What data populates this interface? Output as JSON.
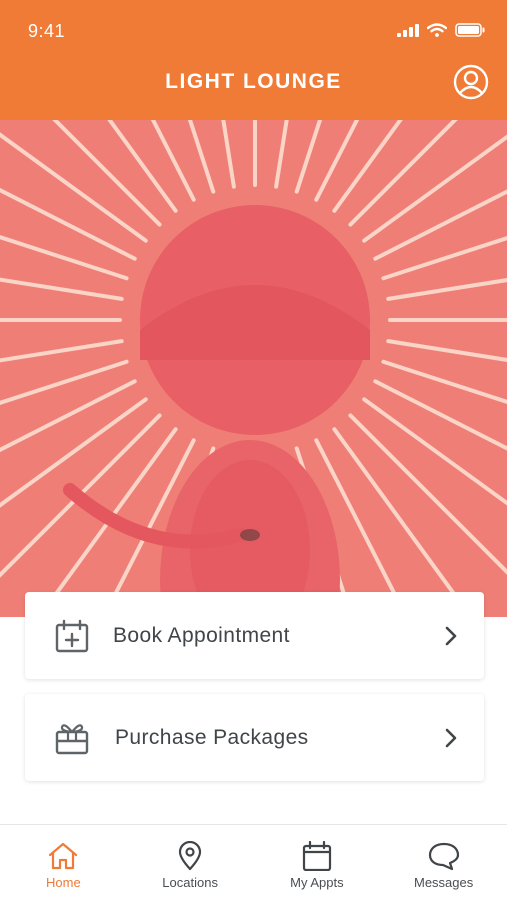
{
  "status_bar": {
    "time": "9:41"
  },
  "header": {
    "title": "LIGHT LOUNGE"
  },
  "carousel": {
    "slide_count": 4,
    "active_index": 0
  },
  "cards": [
    {
      "label": "Book Appointment",
      "icon": "calendar-plus-icon"
    },
    {
      "label": "Purchase Packages",
      "icon": "gift-box-icon"
    }
  ],
  "tabs": [
    {
      "label": "Home",
      "icon": "home-icon",
      "active": true
    },
    {
      "label": "Locations",
      "icon": "location-pin-icon",
      "active": false
    },
    {
      "label": "My Appts",
      "icon": "calendar-icon",
      "active": false
    },
    {
      "label": "Messages",
      "icon": "chat-bubble-icon",
      "active": false
    }
  ],
  "colors": {
    "brand": "#ef7b37",
    "hero_tint": "#ef7a72",
    "text": "#3f4548"
  }
}
